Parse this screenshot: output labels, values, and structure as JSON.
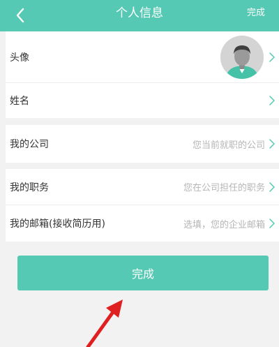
{
  "header": {
    "title": "个人信息",
    "done_label": "完成",
    "back_icon": "chevron-left-icon"
  },
  "profile": {
    "avatar_label": "头像",
    "name_label": "姓名"
  },
  "company": {
    "label": "我的公司",
    "placeholder": "您当前就职的公司"
  },
  "job": {
    "position_label": "我的职务",
    "position_placeholder": "您在公司担任的职务",
    "email_label": "我的邮箱(接收简历用)",
    "email_placeholder": "选填，您的企业邮箱"
  },
  "submit": {
    "label": "完成"
  },
  "colors": {
    "accent": "#55c9b3",
    "background": "#f2f2f2",
    "annotation_arrow": "#e02020"
  }
}
